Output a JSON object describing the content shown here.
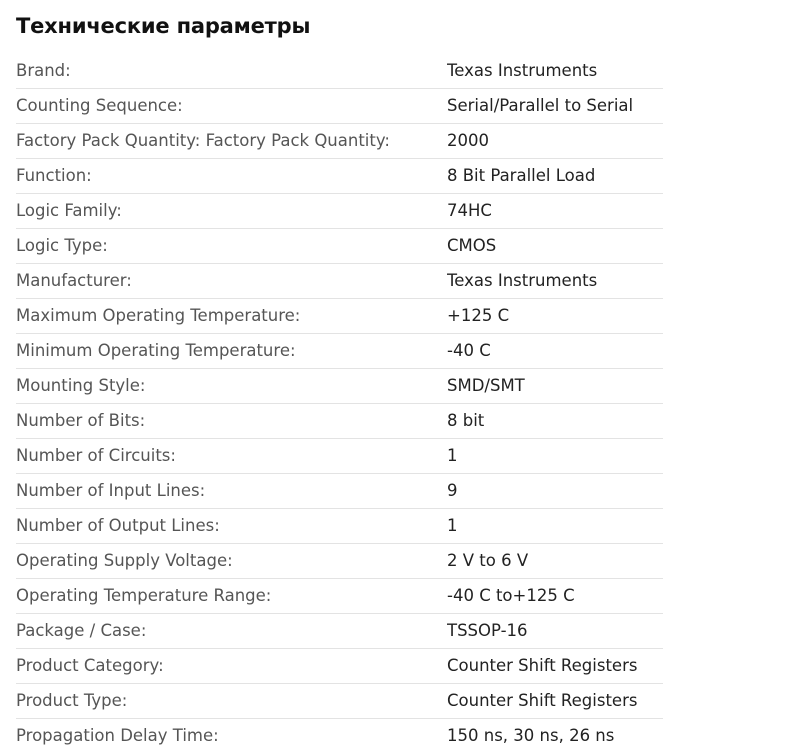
{
  "section_title": "Технические параметры",
  "specs": [
    {
      "label": "Brand:",
      "value": "Texas Instruments"
    },
    {
      "label": "Counting Sequence:",
      "value": "Serial/Parallel to Serial"
    },
    {
      "label": "Factory Pack Quantity: Factory Pack Quantity:",
      "value": "2000"
    },
    {
      "label": "Function:",
      "value": "8 Bit Parallel Load"
    },
    {
      "label": "Logic Family:",
      "value": "74HC"
    },
    {
      "label": "Logic Type:",
      "value": "CMOS"
    },
    {
      "label": "Manufacturer:",
      "value": "Texas Instruments"
    },
    {
      "label": "Maximum Operating Temperature:",
      "value": "+125 C"
    },
    {
      "label": "Minimum Operating Temperature:",
      "value": "-40 C"
    },
    {
      "label": "Mounting Style:",
      "value": "SMD/SMT"
    },
    {
      "label": "Number of Bits:",
      "value": "8 bit"
    },
    {
      "label": "Number of Circuits:",
      "value": "1"
    },
    {
      "label": "Number of Input Lines:",
      "value": "9"
    },
    {
      "label": "Number of Output Lines:",
      "value": "1"
    },
    {
      "label": "Operating Supply Voltage:",
      "value": "2 V to 6 V"
    },
    {
      "label": "Operating Temperature Range:",
      "value": "-40 C to+125 C"
    },
    {
      "label": "Package / Case:",
      "value": "TSSOP-16"
    },
    {
      "label": "Product Category:",
      "value": "Counter Shift Registers"
    },
    {
      "label": "Product Type:",
      "value": "Counter Shift Registers"
    },
    {
      "label": "Propagation Delay Time:",
      "value": "150 ns, 30 ns, 26 ns"
    }
  ]
}
